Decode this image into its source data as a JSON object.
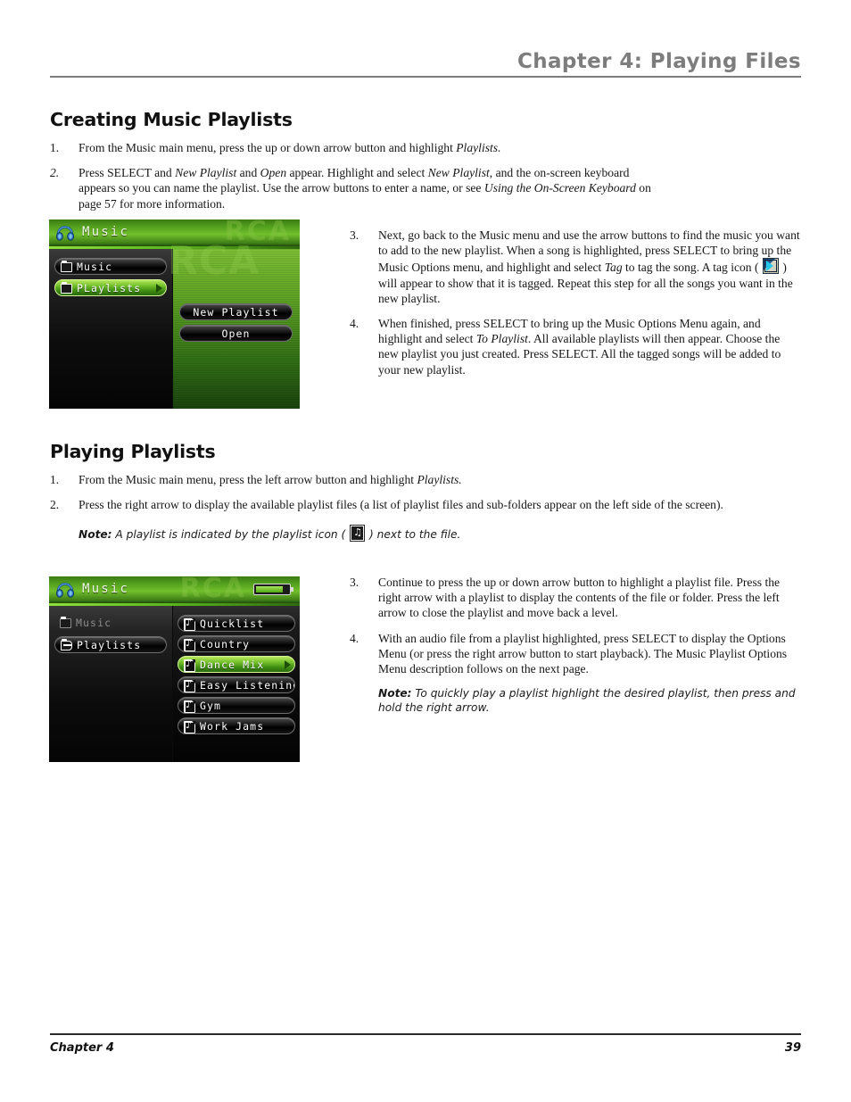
{
  "header": {
    "chapter_title": "Chapter 4: Playing Files"
  },
  "sections": [
    {
      "heading": "Creating Music Playlists",
      "steps_left": [
        {
          "number": "1.",
          "text_parts": [
            {
              "t": "From the Music main menu, press the up or down arrow button and highlight ",
              "i": false
            },
            {
              "t": "Playlists.",
              "i": true
            }
          ]
        },
        {
          "number": "2.",
          "text_parts": [
            {
              "t": "Press SELECT and ",
              "i": false
            },
            {
              "t": "New Playlist",
              "i": true
            },
            {
              "t": " and ",
              "i": false
            },
            {
              "t": "Open",
              "i": true
            },
            {
              "t": " appear. Highlight and select ",
              "i": false
            },
            {
              "t": "New Playlist",
              "i": true
            },
            {
              "t": ",  and the on-screen keyboard appears so you can name the playlist. Use the arrow buttons to enter a name, or see ",
              "i": false
            },
            {
              "t": "Using the On-Screen Keyboard",
              "i": true
            },
            {
              "t": " on page 57 for more information.",
              "i": false
            }
          ]
        }
      ],
      "steps_right": [
        {
          "number": "3.",
          "text_parts": [
            {
              "t": "Next, go back to the Music menu and use the arrow buttons to find the music you want to add to the new playlist. When a song is highlighted, press SELECT to bring up the Music Options menu, and highlight and select ",
              "i": false
            },
            {
              "t": "Tag",
              "i": true
            },
            {
              "t": " to tag the song. A tag icon ( ",
              "i": false
            },
            {
              "t": "[TAG_ICON]",
              "i": false
            },
            {
              "t": " ) will appear to show that it is tagged. Repeat this step for all the songs you want in the new playlist.",
              "i": false
            }
          ]
        },
        {
          "number": "4.",
          "text_parts": [
            {
              "t": "When finished, press SELECT to bring up the Music Options Menu again, and highlight and select ",
              "i": false
            },
            {
              "t": "To Playlist",
              "i": true
            },
            {
              "t": ". All available playlists will then appear. Choose the new playlist you just created. Press SELECT. All the tagged songs will be added to your new playlist.",
              "i": false
            }
          ]
        }
      ]
    },
    {
      "heading": "Playing Playlists",
      "steps_left": [
        {
          "number": "1.",
          "text_parts": [
            {
              "t": "From the Music main menu, press the left arrow button and highlight ",
              "i": false
            },
            {
              "t": "Playlists.",
              "i": true
            }
          ]
        },
        {
          "number": "2.",
          "text_parts": [
            {
              "t": "Press the right arrow to display the available playlist files (a list of playlist files and sub-folders appear on the left side of the screen).",
              "i": false
            }
          ]
        }
      ],
      "note_left": {
        "label": "Note:",
        "before": " A playlist is indicated by the playlist icon ( ",
        "after": " ) next to the file."
      },
      "steps_right": [
        {
          "number": "3.",
          "text_parts": [
            {
              "t": "Continue to press the up or down arrow button to highlight a playlist file. Press the right arrow with a playlist to display the contents of the file or folder. Press the left arrow to close the playlist and move back a level.",
              "i": false
            }
          ]
        },
        {
          "number": "4.",
          "text_parts": [
            {
              "t": "With an audio file from a playlist highlighted, press SELECT to display the Options Menu (or press the right arrow button to start playback). The Music Playlist Options Menu description follows on the next page.",
              "i": false
            }
          ]
        }
      ],
      "note_right": {
        "label": "Note:",
        "text": " To quickly play a playlist highlight the desired playlist, then press and hold the right arrow."
      }
    }
  ],
  "device_screen_1": {
    "title": "Music",
    "watermark": "RCA",
    "left_menu": [
      {
        "label": "Music",
        "selected": false,
        "icon": "folder-closed-icon"
      },
      {
        "label": "PLaylists",
        "selected": true,
        "icon": "folder-closed-icon"
      }
    ],
    "right_menu": [
      {
        "label": "New Playlist",
        "selected": false
      },
      {
        "label": "Open",
        "selected": false
      }
    ]
  },
  "device_screen_2": {
    "title": "Music",
    "watermark": "RCA",
    "battery": "full",
    "left_menu": [
      {
        "label": "Music",
        "selected": false,
        "dimmed": true,
        "icon": "folder-closed-icon"
      },
      {
        "label": "Playlists",
        "selected": false,
        "dimmed": false,
        "icon": "folder-open-icon"
      }
    ],
    "right_menu": [
      {
        "label": "Quicklist",
        "selected": false,
        "icon": "playlist-icon"
      },
      {
        "label": "Country",
        "selected": false,
        "icon": "playlist-icon"
      },
      {
        "label": "Dance Mix",
        "selected": true,
        "icon": "playlist-icon"
      },
      {
        "label": "Easy Listening",
        "selected": false,
        "icon": "playlist-icon"
      },
      {
        "label": "Gym",
        "selected": false,
        "icon": "playlist-icon"
      },
      {
        "label": "Work Jams",
        "selected": false,
        "icon": "playlist-icon"
      }
    ]
  },
  "footer": {
    "left": "Chapter 4",
    "right": "39"
  },
  "colors": {
    "header_gray": "#7d7d7d",
    "screen_green": "#5fa622",
    "selected_green": "#76c22c",
    "text_black": "#161616"
  }
}
